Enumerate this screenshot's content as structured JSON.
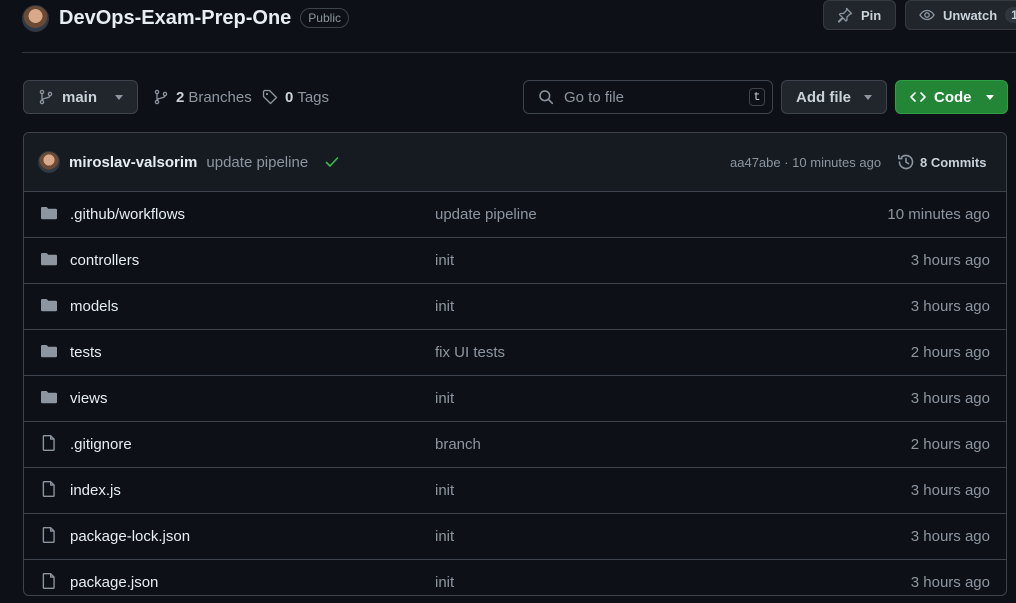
{
  "repo": {
    "name": "DevOps-Exam-Prep-One",
    "visibility": "Public",
    "pin_label": "Pin",
    "watch_label": "Unwatch",
    "watch_count": "1"
  },
  "toolbar": {
    "branch": "main",
    "branches_count": "2",
    "branches_label": "Branches",
    "tags_count": "0",
    "tags_label": "Tags",
    "search_placeholder": "Go to file",
    "search_shortcut": "t",
    "add_file_label": "Add file",
    "code_label": "Code"
  },
  "latest_commit": {
    "author": "miroslav-valsorim",
    "message": "update pipeline",
    "status": "success",
    "meta": "aa47abe · 10 minutes ago",
    "commits_label": "8 Commits"
  },
  "files": [
    {
      "type": "folder",
      "name": ".github/workflows",
      "message": "update pipeline",
      "time": "10 minutes ago"
    },
    {
      "type": "folder",
      "name": "controllers",
      "message": "init",
      "time": "3 hours ago"
    },
    {
      "type": "folder",
      "name": "models",
      "message": "init",
      "time": "3 hours ago"
    },
    {
      "type": "folder",
      "name": "tests",
      "message": "fix UI tests",
      "time": "2 hours ago"
    },
    {
      "type": "folder",
      "name": "views",
      "message": "init",
      "time": "3 hours ago"
    },
    {
      "type": "file",
      "name": ".gitignore",
      "message": "branch",
      "time": "2 hours ago"
    },
    {
      "type": "file",
      "name": "index.js",
      "message": "init",
      "time": "3 hours ago"
    },
    {
      "type": "file",
      "name": "package-lock.json",
      "message": "init",
      "time": "3 hours ago"
    },
    {
      "type": "file",
      "name": "package.json",
      "message": "init",
      "time": "3 hours ago"
    }
  ],
  "colors": {
    "background": "#0d1117",
    "border": "#3d444d",
    "text_muted": "#8d96a0",
    "code_button": "#238636",
    "success": "#3fb950"
  }
}
